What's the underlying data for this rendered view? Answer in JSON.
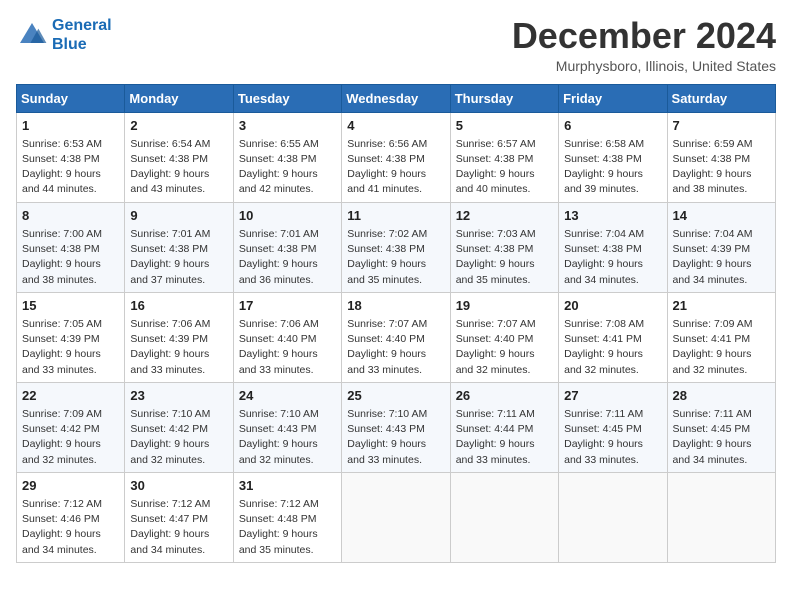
{
  "header": {
    "logo_line1": "General",
    "logo_line2": "Blue",
    "month_title": "December 2024",
    "location": "Murphysboro, Illinois, United States"
  },
  "weekdays": [
    "Sunday",
    "Monday",
    "Tuesday",
    "Wednesday",
    "Thursday",
    "Friday",
    "Saturday"
  ],
  "weeks": [
    [
      {
        "day": "1",
        "sunrise": "6:53 AM",
        "sunset": "4:38 PM",
        "daylight": "9 hours and 44 minutes."
      },
      {
        "day": "2",
        "sunrise": "6:54 AM",
        "sunset": "4:38 PM",
        "daylight": "9 hours and 43 minutes."
      },
      {
        "day": "3",
        "sunrise": "6:55 AM",
        "sunset": "4:38 PM",
        "daylight": "9 hours and 42 minutes."
      },
      {
        "day": "4",
        "sunrise": "6:56 AM",
        "sunset": "4:38 PM",
        "daylight": "9 hours and 41 minutes."
      },
      {
        "day": "5",
        "sunrise": "6:57 AM",
        "sunset": "4:38 PM",
        "daylight": "9 hours and 40 minutes."
      },
      {
        "day": "6",
        "sunrise": "6:58 AM",
        "sunset": "4:38 PM",
        "daylight": "9 hours and 39 minutes."
      },
      {
        "day": "7",
        "sunrise": "6:59 AM",
        "sunset": "4:38 PM",
        "daylight": "9 hours and 38 minutes."
      }
    ],
    [
      {
        "day": "8",
        "sunrise": "7:00 AM",
        "sunset": "4:38 PM",
        "daylight": "9 hours and 38 minutes."
      },
      {
        "day": "9",
        "sunrise": "7:01 AM",
        "sunset": "4:38 PM",
        "daylight": "9 hours and 37 minutes."
      },
      {
        "day": "10",
        "sunrise": "7:01 AM",
        "sunset": "4:38 PM",
        "daylight": "9 hours and 36 minutes."
      },
      {
        "day": "11",
        "sunrise": "7:02 AM",
        "sunset": "4:38 PM",
        "daylight": "9 hours and 35 minutes."
      },
      {
        "day": "12",
        "sunrise": "7:03 AM",
        "sunset": "4:38 PM",
        "daylight": "9 hours and 35 minutes."
      },
      {
        "day": "13",
        "sunrise": "7:04 AM",
        "sunset": "4:38 PM",
        "daylight": "9 hours and 34 minutes."
      },
      {
        "day": "14",
        "sunrise": "7:04 AM",
        "sunset": "4:39 PM",
        "daylight": "9 hours and 34 minutes."
      }
    ],
    [
      {
        "day": "15",
        "sunrise": "7:05 AM",
        "sunset": "4:39 PM",
        "daylight": "9 hours and 33 minutes."
      },
      {
        "day": "16",
        "sunrise": "7:06 AM",
        "sunset": "4:39 PM",
        "daylight": "9 hours and 33 minutes."
      },
      {
        "day": "17",
        "sunrise": "7:06 AM",
        "sunset": "4:40 PM",
        "daylight": "9 hours and 33 minutes."
      },
      {
        "day": "18",
        "sunrise": "7:07 AM",
        "sunset": "4:40 PM",
        "daylight": "9 hours and 33 minutes."
      },
      {
        "day": "19",
        "sunrise": "7:07 AM",
        "sunset": "4:40 PM",
        "daylight": "9 hours and 32 minutes."
      },
      {
        "day": "20",
        "sunrise": "7:08 AM",
        "sunset": "4:41 PM",
        "daylight": "9 hours and 32 minutes."
      },
      {
        "day": "21",
        "sunrise": "7:09 AM",
        "sunset": "4:41 PM",
        "daylight": "9 hours and 32 minutes."
      }
    ],
    [
      {
        "day": "22",
        "sunrise": "7:09 AM",
        "sunset": "4:42 PM",
        "daylight": "9 hours and 32 minutes."
      },
      {
        "day": "23",
        "sunrise": "7:10 AM",
        "sunset": "4:42 PM",
        "daylight": "9 hours and 32 minutes."
      },
      {
        "day": "24",
        "sunrise": "7:10 AM",
        "sunset": "4:43 PM",
        "daylight": "9 hours and 32 minutes."
      },
      {
        "day": "25",
        "sunrise": "7:10 AM",
        "sunset": "4:43 PM",
        "daylight": "9 hours and 33 minutes."
      },
      {
        "day": "26",
        "sunrise": "7:11 AM",
        "sunset": "4:44 PM",
        "daylight": "9 hours and 33 minutes."
      },
      {
        "day": "27",
        "sunrise": "7:11 AM",
        "sunset": "4:45 PM",
        "daylight": "9 hours and 33 minutes."
      },
      {
        "day": "28",
        "sunrise": "7:11 AM",
        "sunset": "4:45 PM",
        "daylight": "9 hours and 34 minutes."
      }
    ],
    [
      {
        "day": "29",
        "sunrise": "7:12 AM",
        "sunset": "4:46 PM",
        "daylight": "9 hours and 34 minutes."
      },
      {
        "day": "30",
        "sunrise": "7:12 AM",
        "sunset": "4:47 PM",
        "daylight": "9 hours and 34 minutes."
      },
      {
        "day": "31",
        "sunrise": "7:12 AM",
        "sunset": "4:48 PM",
        "daylight": "9 hours and 35 minutes."
      },
      null,
      null,
      null,
      null
    ]
  ]
}
